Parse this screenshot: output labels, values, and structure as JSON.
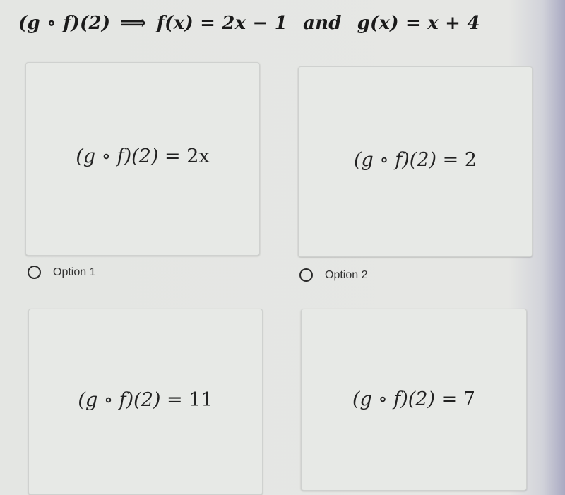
{
  "question": {
    "lhs": "(g ∘ f)(2)",
    "arrow": "⟹",
    "f_def": "f(x) = 2x − 1",
    "connector": "and",
    "g_def": "g(x) = x + 4"
  },
  "options": [
    {
      "expr_lhs": "(g ∘ f)(2)",
      "expr_rhs": "= 2x",
      "label": "Option 1",
      "selected": false
    },
    {
      "expr_lhs": "(g ∘ f)(2)",
      "expr_rhs": "= 2",
      "label": "Option 2",
      "selected": false
    },
    {
      "expr_lhs": "(g ∘ f)(2)",
      "expr_rhs": "= 11",
      "label": "",
      "selected": false
    },
    {
      "expr_lhs": "(g ∘ f)(2)",
      "expr_rhs": "= 7",
      "label": "",
      "selected": false
    }
  ]
}
